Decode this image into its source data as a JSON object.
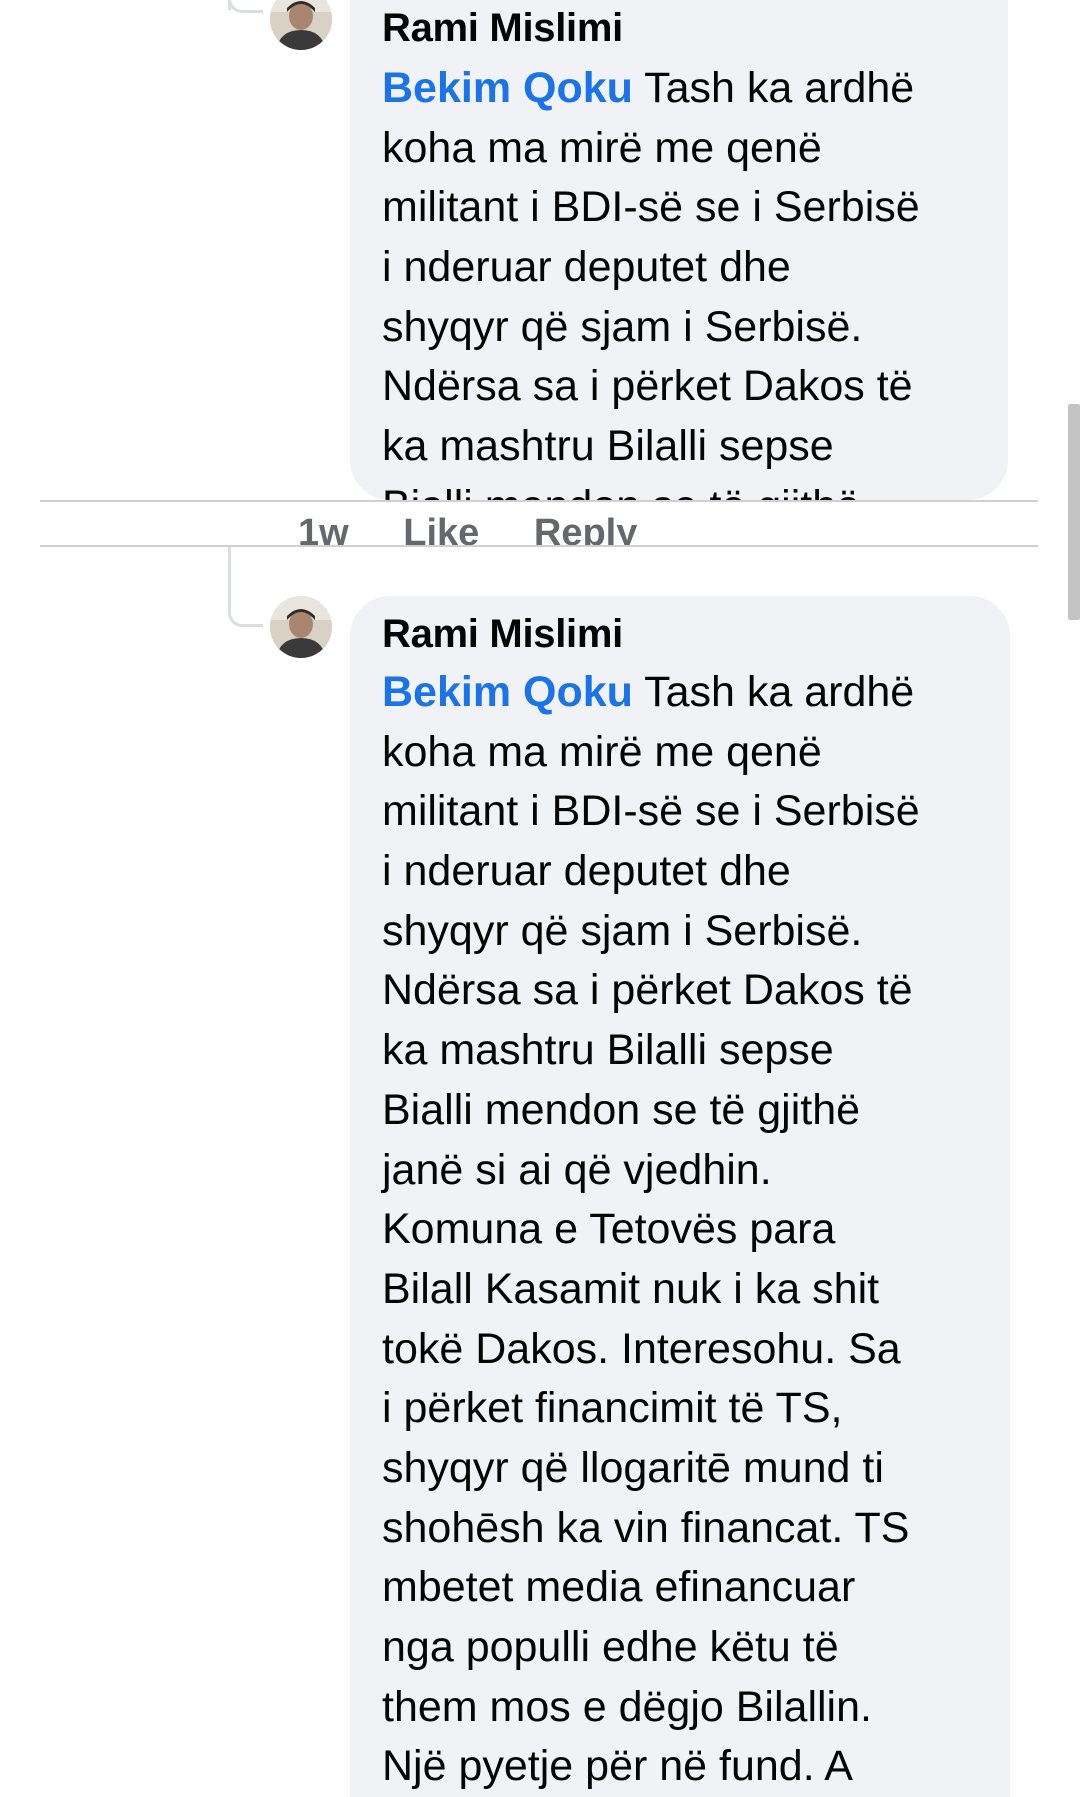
{
  "comments": [
    {
      "author": "Rami Mislimi",
      "mention": "Bekim Qoku",
      "first_line_rest": " Tash ka ardhë",
      "lines": [
        "koha ma mirë me qenë",
        "militant i BDI-së se i Serbisë",
        "i nderuar deputet dhe",
        "shyqyr që sjam i Serbisë.",
        "Ndërsa sa i përket Dakos të",
        "ka mashtru Bilalli sepse",
        "Bialli mendon se të gjithë"
      ]
    },
    {
      "author": "Rami Mislimi",
      "mention": "Bekim Qoku",
      "first_line_rest": " Tash ka ardhë",
      "lines": [
        "koha ma mirë me qenë",
        "militant i BDI-së se i Serbisë",
        "i nderuar deputet dhe",
        "shyqyr që sjam i Serbisë.",
        "Ndërsa sa i përket Dakos të",
        "ka mashtru Bilalli sepse",
        "Bialli mendon se të gjithë",
        "janë si ai që vjedhin.",
        "Komuna e Tetovës para",
        "Bilall Kasamit nuk i ka shit",
        "tokë Dakos. Interesohu.  Sa",
        "i përket financimit të TS,",
        "shyqyr që llogaritē mund ti",
        "shohēsh ka vin financat. TS",
        "mbetet media efinancuar",
        "nga populli edhe këtu të",
        "them mos e dëgjo Bilallin.",
        "Një pyetje për në fund. A"
      ]
    }
  ],
  "actions": {
    "time": "1w",
    "like": "Like",
    "reply": "Reply"
  },
  "colors": {
    "bubble": "#f0f2f5",
    "mention": "#1a73e8",
    "text": "#050505",
    "thread_line": "#dadde1"
  }
}
